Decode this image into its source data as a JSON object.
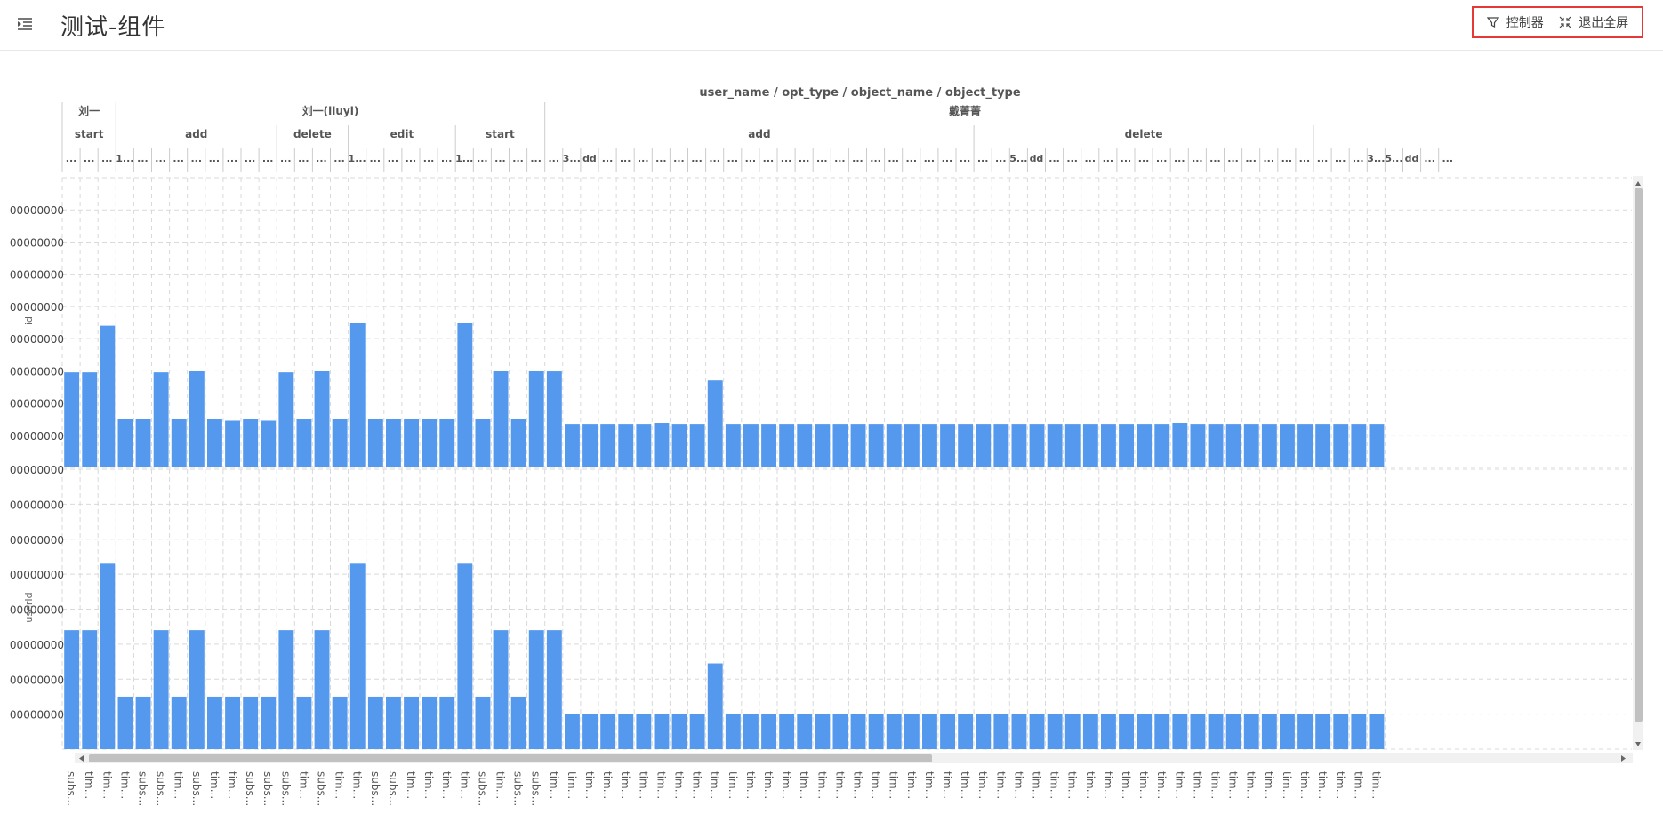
{
  "page": {
    "title": "测试-组件"
  },
  "toolbar": {
    "controller_label": "控制器",
    "exit_fullscreen_label": "退出全屏",
    "icons": {
      "menu": "menu-fold-icon",
      "controller": "filter-icon",
      "exit_fullscreen": "shrink-icon"
    }
  },
  "colors": {
    "bar": "#5599ee",
    "highlight_border": "#e53935",
    "grid": "#d9d9d9"
  },
  "chart_data": {
    "type": "bar",
    "title": "user_name / opt_type / object_name / object_type",
    "header_levels": [
      {
        "level": "user_name",
        "groups": [
          {
            "label": "刘一",
            "count": 3
          },
          {
            "label": "刘一(liuyi)",
            "count": 24
          },
          {
            "label": "戴菁菁",
            "count": 47
          }
        ]
      },
      {
        "level": "opt_type",
        "groups": [
          {
            "label": "start",
            "count": 3
          },
          {
            "label": "add",
            "count": 9
          },
          {
            "label": "delete",
            "count": 4
          },
          {
            "label": "edit",
            "count": 6
          },
          {
            "label": "start",
            "count": 5
          },
          {
            "label": "add",
            "count": 24
          },
          {
            "label": "delete",
            "count": 19
          },
          {
            "label": "",
            "count": 4
          }
        ]
      },
      {
        "level": "object_name",
        "labels": [
          "...",
          "...",
          "...",
          "1...",
          "...",
          "...",
          "...",
          "...",
          "...",
          "...",
          "...",
          "...",
          "...",
          "...",
          "...",
          "...",
          "1...",
          "...",
          "...",
          "...",
          "...",
          "...",
          "1...",
          "...",
          "...",
          "...",
          "...",
          "...",
          "3...",
          "dd",
          "...",
          "...",
          "...",
          "...",
          "...",
          "...",
          "...",
          "...",
          "...",
          "...",
          "...",
          "...",
          "...",
          "...",
          "...",
          "...",
          "...",
          "...",
          "...",
          "...",
          "...",
          "...",
          "...",
          "5...",
          "dd",
          "...",
          "...",
          "...",
          "...",
          "...",
          "...",
          "...",
          "...",
          "...",
          "...",
          "...",
          "...",
          "...",
          "...",
          "...",
          "...",
          "...",
          "...",
          "3...",
          "5...",
          "dd",
          "...",
          "..."
        ]
      }
    ],
    "categories": [
      "subs...",
      "tim...",
      "tim...",
      "tim...",
      "subs...",
      "subs...",
      "tim...",
      "subs...",
      "tim...",
      "tim...",
      "subs...",
      "subs...",
      "subs...",
      "tim...",
      "subs...",
      "tim...",
      "tim...",
      "subs...",
      "subs...",
      "tim...",
      "tim...",
      "tim...",
      "tim...",
      "subs...",
      "tim...",
      "subs...",
      "subs...",
      "tim...",
      "tim...",
      "tim...",
      "tim...",
      "tim...",
      "tim...",
      "tim...",
      "tim...",
      "tim...",
      "tim...",
      "tim...",
      "tim...",
      "tim...",
      "tim...",
      "tim...",
      "tim...",
      "tim...",
      "tim...",
      "tim...",
      "tim...",
      "tim...",
      "tim...",
      "tim...",
      "tim...",
      "tim...",
      "tim...",
      "tim...",
      "tim...",
      "tim...",
      "tim...",
      "tim...",
      "tim...",
      "tim...",
      "tim...",
      "tim...",
      "tim...",
      "tim...",
      "tim...",
      "tim...",
      "tim...",
      "tim...",
      "tim...",
      "tim...",
      "tim...",
      "tim...",
      "tim...",
      "tim..."
    ],
    "panels": [
      {
        "ylabel": "id",
        "yticks": [
          "00000000",
          "00000000",
          "00000000",
          "00000000",
          "00000000",
          "00000000",
          "00000000",
          "00000000"
        ],
        "ylim": [
          0,
          9
        ],
        "values": [
          2.95,
          2.95,
          4.4,
          1.5,
          1.5,
          2.95,
          1.5,
          3.0,
          1.5,
          1.45,
          1.5,
          1.45,
          2.95,
          1.5,
          3.0,
          1.5,
          4.5,
          1.5,
          1.5,
          1.5,
          1.5,
          1.5,
          4.5,
          1.5,
          3.0,
          1.5,
          3.0,
          2.98,
          1.35,
          1.35,
          1.35,
          1.35,
          1.35,
          1.38,
          1.35,
          1.35,
          2.7,
          1.35,
          1.35,
          1.35,
          1.35,
          1.35,
          1.35,
          1.35,
          1.35,
          1.35,
          1.35,
          1.35,
          1.35,
          1.35,
          1.35,
          1.35,
          1.35,
          1.35,
          1.35,
          1.35,
          1.35,
          1.35,
          1.35,
          1.35,
          1.35,
          1.35,
          1.38,
          1.35,
          1.35,
          1.35,
          1.35,
          1.35,
          1.35,
          1.35,
          1.35,
          1.35,
          1.35,
          1.35
        ]
      },
      {
        "ylabel": "userId",
        "yticks": [
          "00000000",
          "00000000",
          "00000000",
          "00000000",
          "00000000",
          "00000000",
          "00000000",
          "00000000"
        ],
        "ylim": [
          0,
          8
        ],
        "values": [
          3.4,
          3.4,
          5.3,
          1.5,
          1.5,
          3.4,
          1.5,
          3.4,
          1.5,
          1.5,
          1.5,
          1.5,
          3.4,
          1.5,
          3.4,
          1.5,
          5.3,
          1.5,
          1.5,
          1.5,
          1.5,
          1.5,
          5.3,
          1.5,
          3.4,
          1.5,
          3.4,
          3.4,
          1.0,
          1.0,
          1.0,
          1.0,
          1.0,
          1.0,
          1.0,
          1.0,
          2.45,
          1.0,
          1.0,
          1.0,
          1.0,
          1.0,
          1.0,
          1.0,
          1.0,
          1.0,
          1.0,
          1.0,
          1.0,
          1.0,
          1.0,
          1.0,
          1.0,
          1.0,
          1.0,
          1.0,
          1.0,
          1.0,
          1.0,
          1.0,
          1.0,
          1.0,
          1.0,
          1.0,
          1.0,
          1.0,
          1.0,
          1.0,
          1.0,
          1.0,
          1.0,
          1.0,
          1.0,
          1.0
        ]
      }
    ],
    "grid": true
  }
}
